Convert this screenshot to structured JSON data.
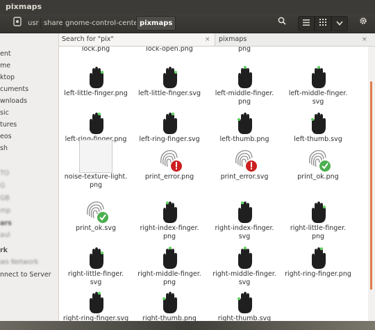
{
  "window": {
    "title": "pixmaps"
  },
  "toolbar": {
    "path_icon": "drive-icon",
    "crumbs": [
      "usr",
      "share",
      "gnome-control-center",
      "pixmaps"
    ],
    "search_icon": "⚲",
    "list_icon": "≡",
    "grid_icon": "⋮⋮⋮",
    "menu_icon": "⌄",
    "settings_icon": "⚙"
  },
  "sidebar": {
    "items": [
      "ent",
      "me",
      "ktop",
      "cuments",
      "wnloads",
      "sic",
      "tures",
      "eos",
      "sh",
      "TO",
      "G",
      "GB",
      "mp",
      "ars",
      "aul",
      "rk",
      "ws Network",
      "nnect to Server"
    ]
  },
  "tabs": {
    "search": "Search for \"pix\"",
    "pixmaps": "pixmaps",
    "close": "×"
  },
  "files": {
    "top": [
      "lock.png",
      "lock-open.png",
      "png"
    ],
    "r1": [
      "left-little-finger.png",
      "left-little-finger.svg",
      "left-middle-finger.\npng",
      "left-middle-finger.\nsvg"
    ],
    "r2": [
      "left-ring-finger.png",
      "left-ring-finger.svg",
      "left-thumb.png",
      "left-thumb.svg"
    ],
    "r3": [
      "noise-texture-light.\npng",
      "print_error.png",
      "print_error.svg",
      "print_ok.png"
    ],
    "r4": [
      "print_ok.svg",
      "right-index-finger.\npng",
      "right-index-finger.\nsvg",
      "right-little-finger.\npng"
    ],
    "r5": [
      "right-little-finger.\nsvg",
      "right-middle-finger.\npng",
      "right-middle-finger.\nsvg",
      "right-ring-finger.png"
    ],
    "r6": [
      "right-ring-finger.svg",
      "right-thumb.png",
      "right-thumb.svg"
    ]
  },
  "colors": {
    "accent": "#e07a4b",
    "title_bg": "#3c3b37",
    "ok": "#4caf50",
    "error": "#cc1f1f",
    "finger_dot": "#5fd35f"
  }
}
